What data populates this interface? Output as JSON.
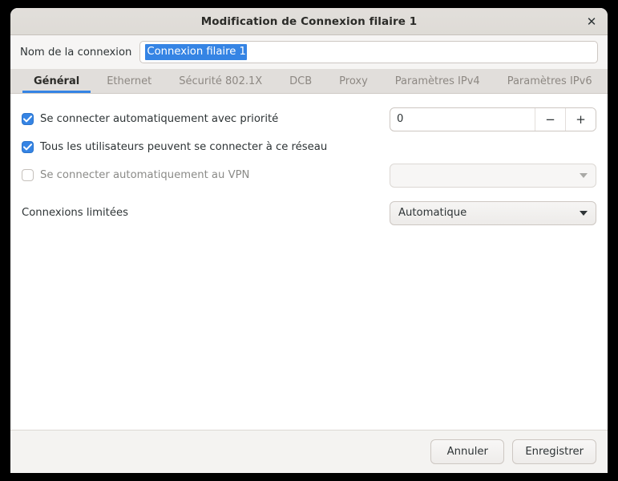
{
  "window": {
    "title": "Modification de Connexion filaire 1",
    "close_icon": "close-icon",
    "close_glyph": "✕"
  },
  "name_row": {
    "label": "Nom de la connexion",
    "value": "Connexion filaire 1",
    "placeholder": "",
    "selected": true,
    "selection_color": "#3584e4"
  },
  "tabs": [
    {
      "label": "Général",
      "active": true
    },
    {
      "label": "Ethernet",
      "active": false
    },
    {
      "label": "Sécurité 802.1X",
      "active": false
    },
    {
      "label": "DCB",
      "active": false
    },
    {
      "label": "Proxy",
      "active": false
    },
    {
      "label": "Paramètres IPv4",
      "active": false
    },
    {
      "label": "Paramètres IPv6",
      "active": false
    }
  ],
  "general": {
    "autoconnect": {
      "label": "Se connecter automatiquement avec priorité",
      "checked": true,
      "priority_value": "0",
      "minus_glyph": "−",
      "plus_glyph": "+"
    },
    "all_users": {
      "label": "Tous les utilisateurs peuvent se connecter à ce réseau",
      "checked": true
    },
    "vpn": {
      "label": "Se connecter automatiquement au VPN",
      "checked": false,
      "dropdown_value": "",
      "dropdown_enabled": false
    },
    "metered": {
      "label": "Connexions limitées",
      "dropdown_value": "Automatique",
      "dropdown_enabled": true
    }
  },
  "footer": {
    "cancel_label": "Annuler",
    "save_label": "Enregistrer"
  },
  "colors": {
    "accent": "#3584e4",
    "titlebar": "#e2dfdb",
    "tabbar": "#e1dedb",
    "footer": "#f4f3f1"
  }
}
